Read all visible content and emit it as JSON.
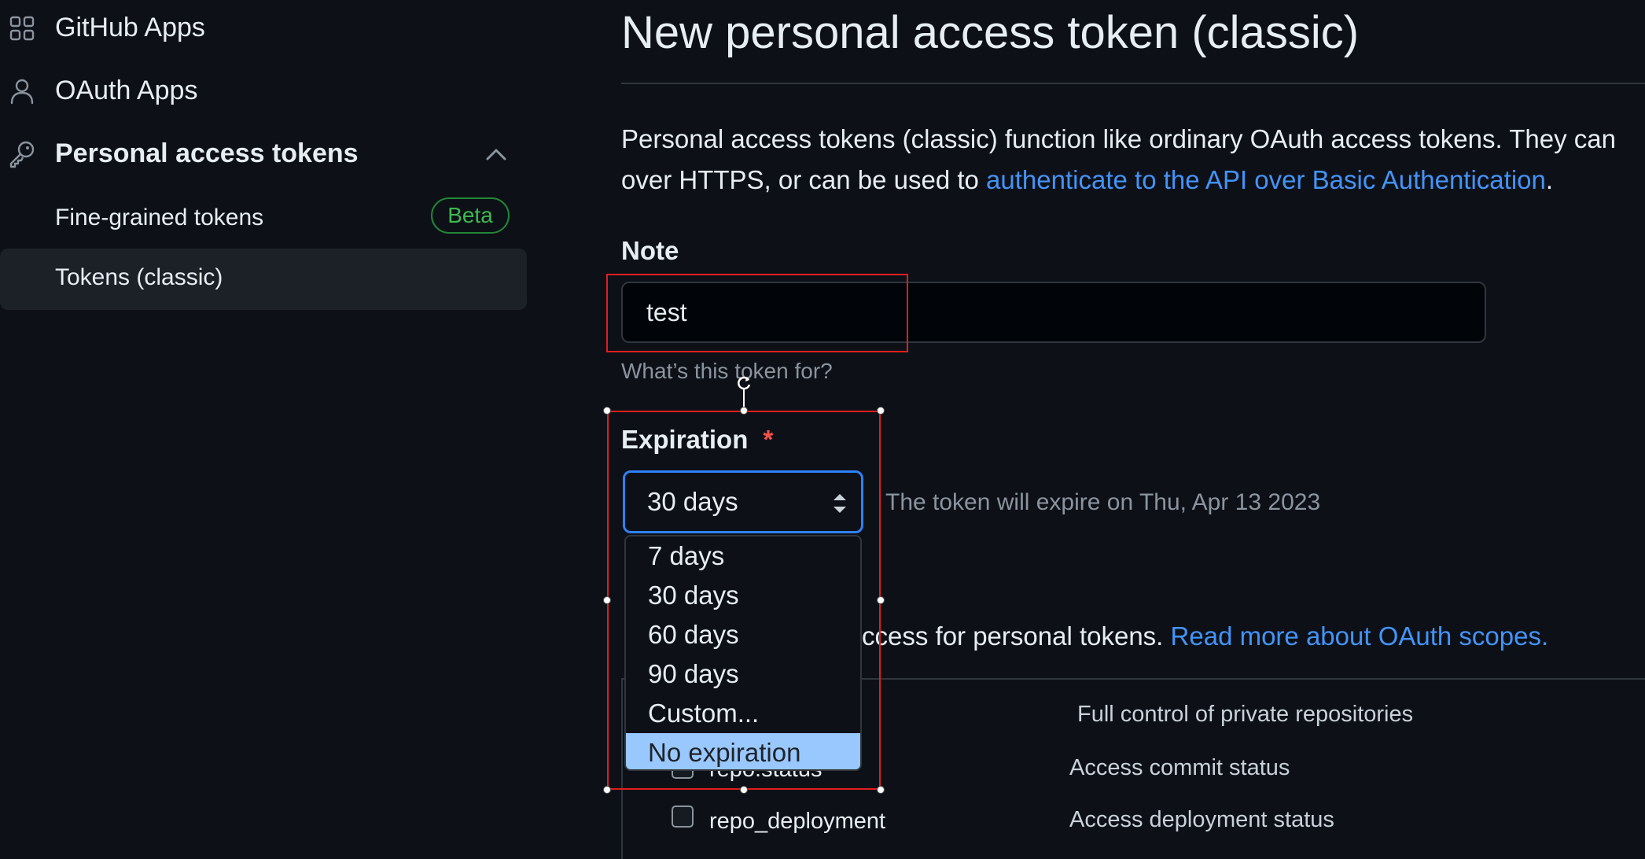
{
  "sidebar": {
    "github_apps": "GitHub Apps",
    "oauth_apps": "OAuth Apps",
    "personal_access_tokens": "Personal access tokens",
    "fine_grained": "Fine-grained tokens",
    "beta_badge": "Beta",
    "tokens_classic": "Tokens (classic)"
  },
  "main": {
    "title": "New personal access token (classic)",
    "description_line1": "Personal access tokens (classic) function like ordinary OAuth access tokens. They can",
    "description_line2_prefix": "over HTTPS, or can be used to ",
    "description_link": "authenticate to the API over Basic Authentication",
    "description_line2_suffix": "."
  },
  "note": {
    "label": "Note",
    "value": "test",
    "hint": "What’s this token for?"
  },
  "expiration": {
    "label": "Expiration",
    "required_mark": "*",
    "selected": "30 days",
    "expiry_text": "The token will expire on Thu, Apr 13 2023",
    "options": [
      "7 days",
      "30 days",
      "60 days",
      "90 days",
      "Custom...",
      "No expiration"
    ],
    "highlighted_option": "No expiration"
  },
  "scopes": {
    "intro_text": "ccess for personal tokens. ",
    "intro_link": "Read more about OAuth scopes.",
    "rows": [
      {
        "name": "",
        "description": "Full control of private repositories"
      },
      {
        "name": "repo:status",
        "description": "Access commit status"
      },
      {
        "name": "repo_deployment",
        "description": "Access deployment status"
      }
    ]
  },
  "colors": {
    "background": "#0d1117",
    "link": "#4493f8",
    "focus_border": "#2f81f7",
    "beta": "#3fb950",
    "annotation": "#e01e1e",
    "option_highlight": "#99c8ff"
  }
}
